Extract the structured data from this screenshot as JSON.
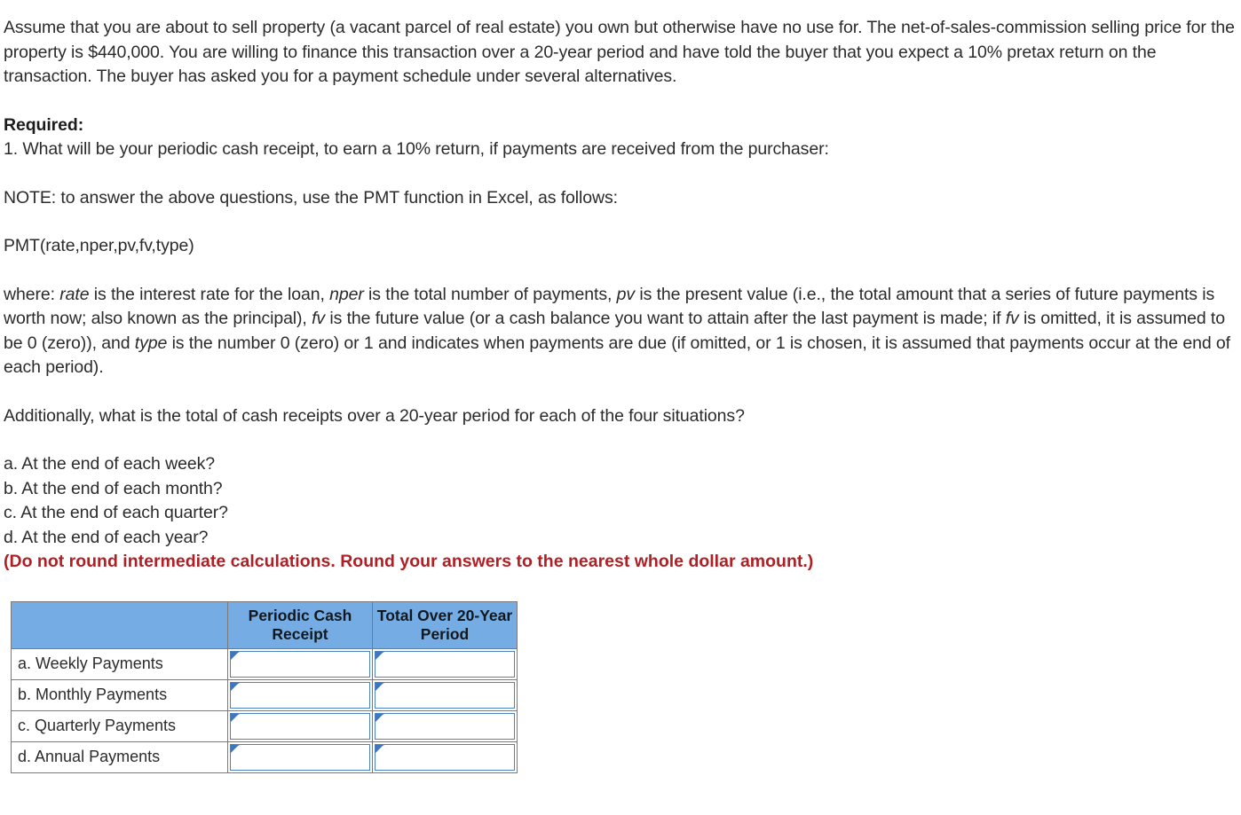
{
  "document": {
    "intro": {
      "text": "Assume that you are about to sell property (a vacant parcel of real estate) you own but otherwise have no use for. The net-of-sales-commission selling price for the property is $440,000. You are willing to finance this transaction over a 20-year period and have told the buyer that you expect a 10% pretax return on the transaction. The buyer has asked you for a payment schedule under several alternatives."
    },
    "required_heading": "Required:",
    "question_1": "1. What will be your periodic cash receipt, to earn a 10% return, if payments are received from the purchaser:",
    "note": "NOTE: to answer the above questions, use the PMT function in Excel, as follows:",
    "formula": "PMT(rate,nper,pv,fv,type)",
    "where": {
      "lead": "where: ",
      "t_rate": "rate",
      "s1": " is the interest rate for the loan, ",
      "t_nper": "nper",
      "s2": " is the total number of payments, ",
      "t_pv": "pv",
      "s3": " is the present value (i.e., the total amount that a series of future payments is worth now; also known as the principal), ",
      "t_fv": "fv",
      "s4": " is the future value (or a cash balance you want to attain after the last payment is made; if ",
      "t_fv2": "fv",
      "s5": " is omitted, it is assumed to be 0 (zero)), and ",
      "t_type": "type",
      "s6": " is the number 0 (zero) or 1 and indicates when payments are due (if omitted, or 1 is chosen, it is assumed that payments occur at the end of each period)."
    },
    "additional": "Additionally, what is the total of cash receipts over a 20-year period for each of the four situations?",
    "options": [
      "a. At the end of each week?",
      "b. At the end of each month?",
      "c. At the end of each quarter?",
      "d. At the end of each year?"
    ],
    "rounding_note": "(Do not round intermediate calculations. Round your answers to the nearest whole dollar amount.)"
  },
  "answer_table": {
    "headers": {
      "blank": "",
      "col1": "Periodic Cash Receipt",
      "col2": "Total Over 20-Year Period"
    },
    "rows": [
      {
        "label": "a. Weekly Payments",
        "periodic_cash_receipt": "",
        "total_over_20_year": ""
      },
      {
        "label": "b. Monthly Payments",
        "periodic_cash_receipt": "",
        "total_over_20_year": ""
      },
      {
        "label": "c. Quarterly Payments",
        "periodic_cash_receipt": "",
        "total_over_20_year": ""
      },
      {
        "label": "d. Annual Payments",
        "periodic_cash_receipt": "",
        "total_over_20_year": ""
      }
    ]
  },
  "colors": {
    "header_blue": "#74ace3",
    "alert_red": "#b01f24",
    "input_border_blue": "#4a82c4",
    "grid_gray": "#7a7a7a",
    "body_text": "#2b2b2b"
  }
}
